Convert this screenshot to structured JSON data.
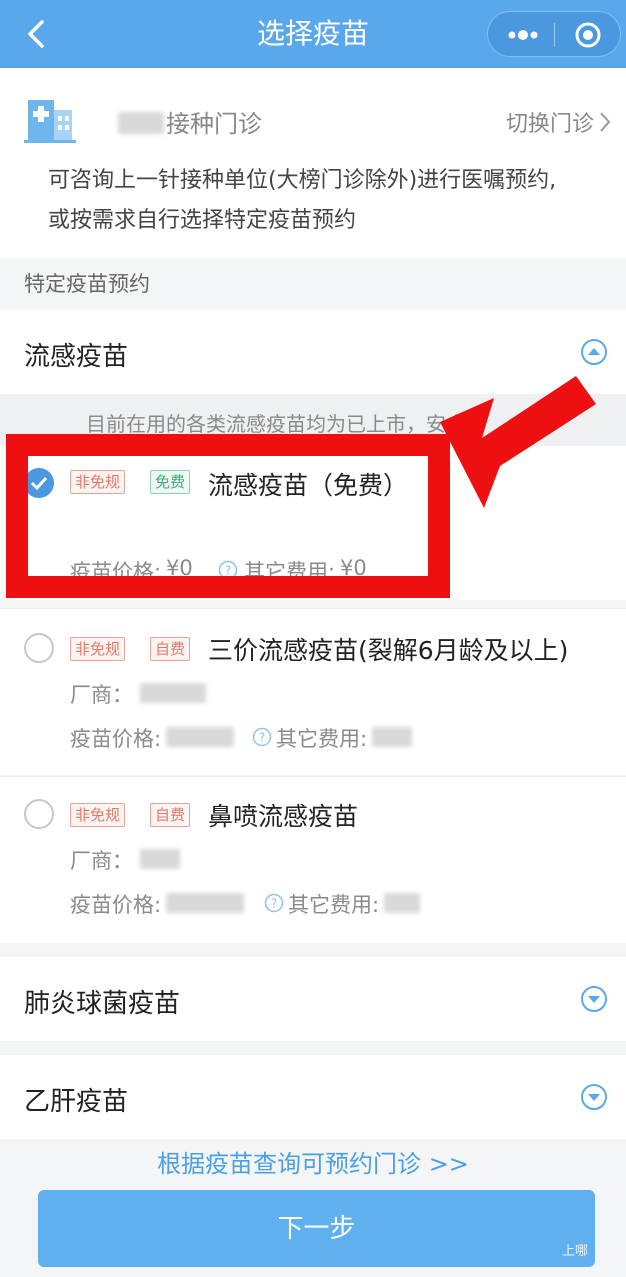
{
  "header": {
    "title": "选择疫苗"
  },
  "clinic": {
    "name": "接种门诊",
    "switch_label": "切换门诊"
  },
  "notice": {
    "line1": "可咨询上一针接种单位(大榜门诊除外)进行医嘱预约,",
    "line2": "或按需求自行选择特定疫苗预约"
  },
  "section_label": "特定疫苗预约",
  "groups": [
    {
      "title": "流感疫苗",
      "marquee": "目前在用的各类流感疫苗均为已上市，安全",
      "items": [
        {
          "tags": [
            "非免规",
            "免费"
          ],
          "name": "流感疫苗（免费）",
          "price_label": "疫苗价格:",
          "price": "¥0",
          "other_label": "其它费用:",
          "other": "¥0",
          "selected": true
        },
        {
          "tags": [
            "非免规",
            "自费"
          ],
          "name": "三价流感疫苗(裂解6月龄及以上)",
          "maker_label": "厂商：",
          "price_label": "疫苗价格:",
          "other_label": "其它费用:",
          "selected": false
        },
        {
          "tags": [
            "非免规",
            "自费"
          ],
          "name": "鼻喷流感疫苗",
          "maker_label": "厂商：",
          "price_label": "疫苗价格:",
          "other_label": "其它费用:",
          "selected": false
        }
      ]
    },
    {
      "title": "肺炎球菌疫苗"
    },
    {
      "title": "乙肝疫苗"
    }
  ],
  "query_link": "根据疫苗查询可预约门诊 >>",
  "next_button": "下一步",
  "watermark": "上哪",
  "colors": {
    "primary": "#5aa8ec",
    "button": "#5fb0ef",
    "link": "#4aa0e6",
    "highlight": "#ee1010"
  }
}
